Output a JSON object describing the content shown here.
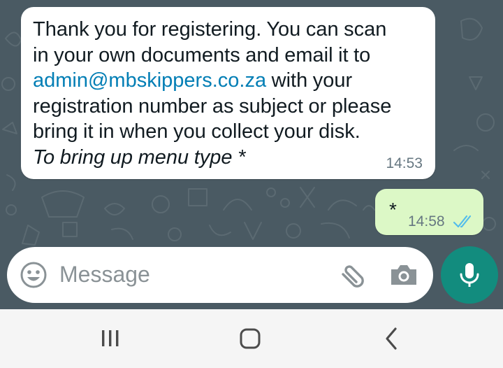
{
  "chat": {
    "incoming": {
      "line1": "Thank you for registering. You can scan",
      "line2": "in your own documents and email it to",
      "link": "admin@mbskippers.co.za",
      "line3_rest": " with your",
      "line4": "registration number as subject or please",
      "line5": "bring it in when you collect your disk.",
      "line6_italic": "To bring up menu type *",
      "time": "14:53"
    },
    "outgoing": {
      "text": "*",
      "time": "14:58",
      "status_icon": "double-check-read-icon",
      "status_color": "#53bdeb"
    }
  },
  "input_bar": {
    "placeholder": "Message",
    "emoji_icon": "emoji-icon",
    "attach_icon": "paperclip-icon",
    "camera_icon": "camera-icon"
  },
  "mic_button": {
    "icon": "microphone-icon",
    "color": "#128c7e"
  },
  "nav": {
    "buttons": [
      "recent-apps-icon",
      "home-icon",
      "back-icon"
    ]
  },
  "colors": {
    "background": "#4a5a63",
    "incoming_bubble": "#ffffff",
    "outgoing_bubble": "#dcf8c6",
    "link": "#027eb5"
  }
}
